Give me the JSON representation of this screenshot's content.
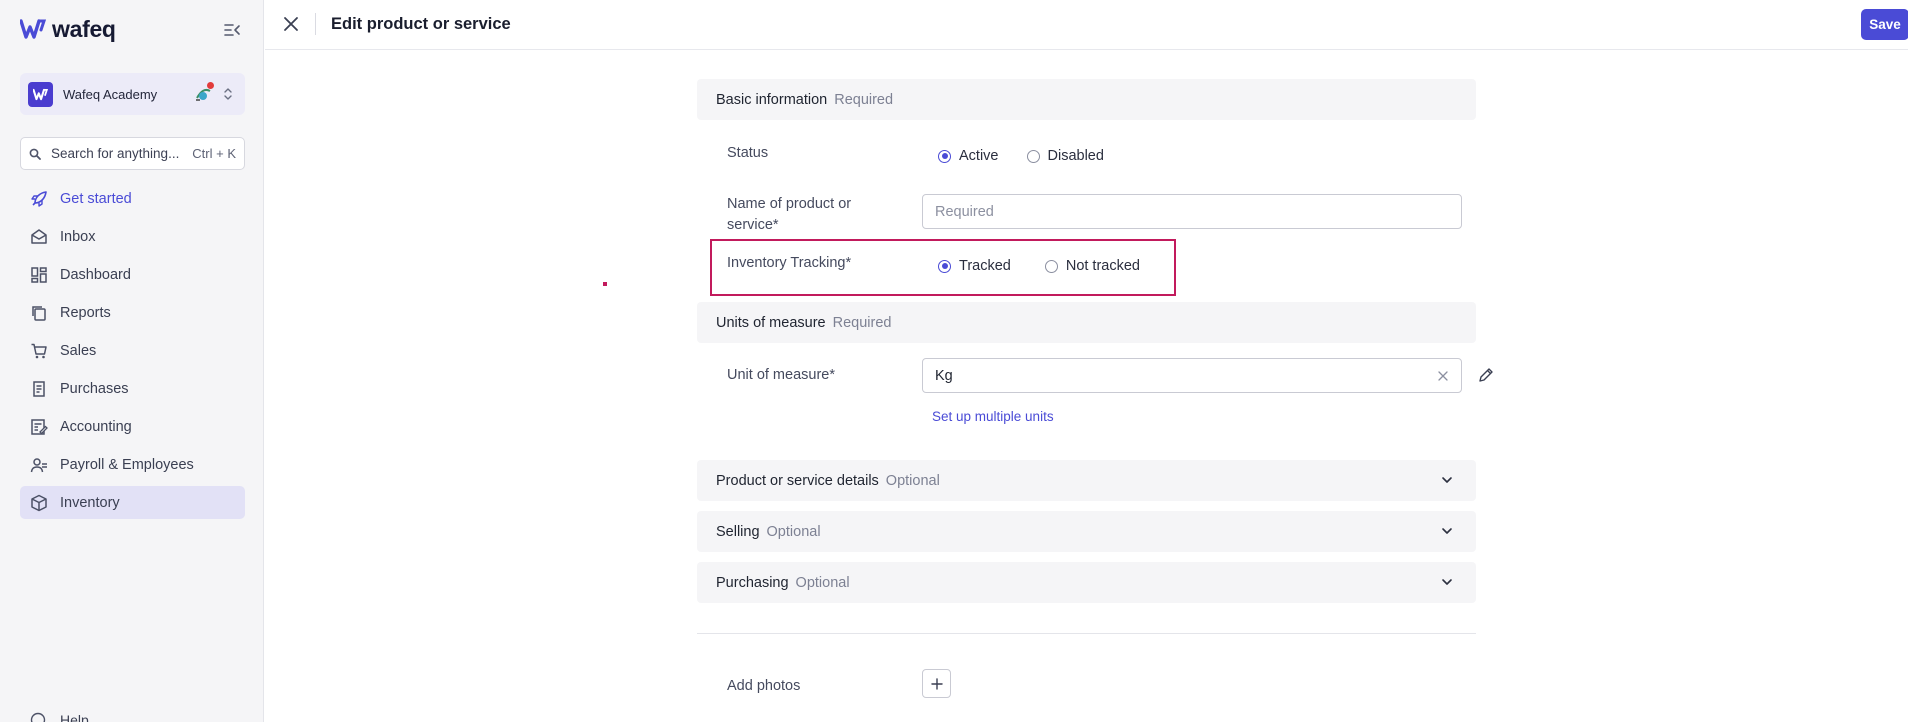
{
  "brand": {
    "name": "wafeq"
  },
  "org": {
    "name": "Wafeq Academy"
  },
  "search": {
    "placeholder": "Search for anything...",
    "shortcut": "Ctrl + K"
  },
  "nav": {
    "items": [
      {
        "label": "Get started",
        "icon": "rocket-icon"
      },
      {
        "label": "Inbox",
        "icon": "envelope-icon"
      },
      {
        "label": "Dashboard",
        "icon": "dashboard-icon"
      },
      {
        "label": "Reports",
        "icon": "reports-icon"
      },
      {
        "label": "Sales",
        "icon": "cart-icon"
      },
      {
        "label": "Purchases",
        "icon": "receipt-icon"
      },
      {
        "label": "Accounting",
        "icon": "ledger-icon"
      },
      {
        "label": "Payroll & Employees",
        "icon": "people-icon"
      },
      {
        "label": "Inventory",
        "icon": "box-icon"
      }
    ],
    "help": "Help"
  },
  "header": {
    "title": "Edit product or service",
    "save_label": "Save"
  },
  "form": {
    "basic": {
      "title": "Basic information",
      "tag": "Required",
      "status_label": "Status",
      "status_options": [
        "Active",
        "Disabled"
      ],
      "status_selected": "Active",
      "name_label": "Name of product or service*",
      "name_placeholder": "Required",
      "name_value": "",
      "tracking_label": "Inventory Tracking*",
      "tracking_options": [
        "Tracked",
        "Not tracked"
      ],
      "tracking_selected": "Tracked"
    },
    "units": {
      "title": "Units of measure",
      "tag": "Required",
      "unit_label": "Unit of measure*",
      "unit_value": "Kg",
      "multi_link": "Set up multiple units"
    },
    "details": {
      "title": "Product or service details",
      "tag": "Optional"
    },
    "selling": {
      "title": "Selling",
      "tag": "Optional"
    },
    "purchasing": {
      "title": "Purchasing",
      "tag": "Optional"
    },
    "photos_label": "Add photos"
  },
  "colors": {
    "accent": "#4a4bd6",
    "highlight": "#c21a5c",
    "sidebar_bg": "#f5f5f7",
    "selected_bg": "#e2e1f6"
  }
}
